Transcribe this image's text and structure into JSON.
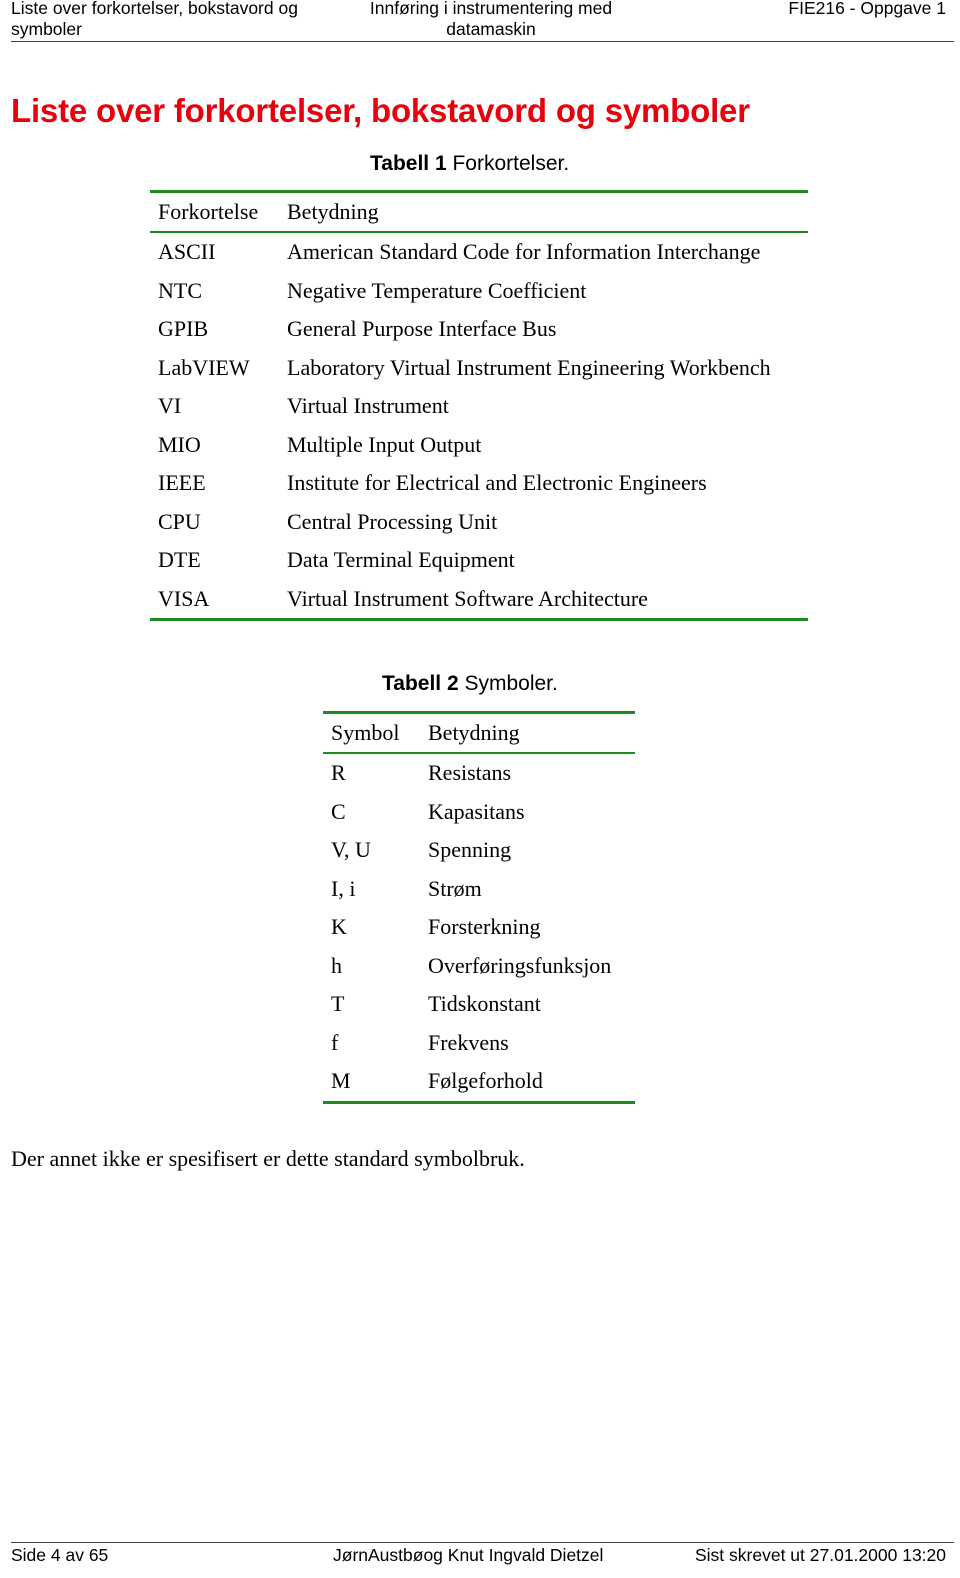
{
  "header": {
    "left": "Liste over forkortelser, bokstavord og symboler",
    "center": "Innføring i instrumentering med datamaskin",
    "right": "FIE216 - Oppgave 1"
  },
  "title": "Liste over forkortelser, bokstavord og symboler",
  "colors": {
    "title": "#e8000c",
    "table_rule": "#1f8a1f"
  },
  "table1": {
    "caption_label": "Tabell 1",
    "caption_text": " Forkortelser.",
    "columns": [
      "Forkortelse",
      "Betydning"
    ],
    "rows": [
      [
        "ASCII",
        "American Standard Code for Information Interchange"
      ],
      [
        "NTC",
        "Negative Temperature Coefficient"
      ],
      [
        "GPIB",
        "General Purpose Interface Bus"
      ],
      [
        "LabVIEW",
        "Laboratory Virtual Instrument Engineering Workbench"
      ],
      [
        "VI",
        "Virtual Instrument"
      ],
      [
        "MIO",
        "Multiple Input Output"
      ],
      [
        "IEEE",
        "Institute for Electrical and Electronic Engineers"
      ],
      [
        "CPU",
        "Central Processing Unit"
      ],
      [
        "DTE",
        "Data Terminal Equipment"
      ],
      [
        "VISA",
        "Virtual Instrument Software Architecture"
      ]
    ]
  },
  "table2": {
    "caption_label": "Tabell 2",
    "caption_text": " Symboler.",
    "columns": [
      "Symbol",
      "Betydning"
    ],
    "rows": [
      [
        "R",
        "Resistans"
      ],
      [
        "C",
        "Kapasitans"
      ],
      [
        "V, U",
        "Spenning"
      ],
      [
        "I, i",
        "Strøm"
      ],
      [
        "K",
        "Forsterkning"
      ],
      [
        "h",
        "Overføringsfunksjon"
      ],
      [
        "T",
        "Tidskonstant"
      ],
      [
        "f",
        "Frekvens"
      ],
      [
        "M",
        "Følgeforhold"
      ]
    ]
  },
  "note": "Der annet ikke er spesifisert er dette standard symbolbruk.",
  "footer": {
    "left": "Side 4 av 65",
    "center": "JørnAustbøog Knut Ingvald Dietzel",
    "right": "Sist skrevet ut 27.01.2000 13:20"
  }
}
